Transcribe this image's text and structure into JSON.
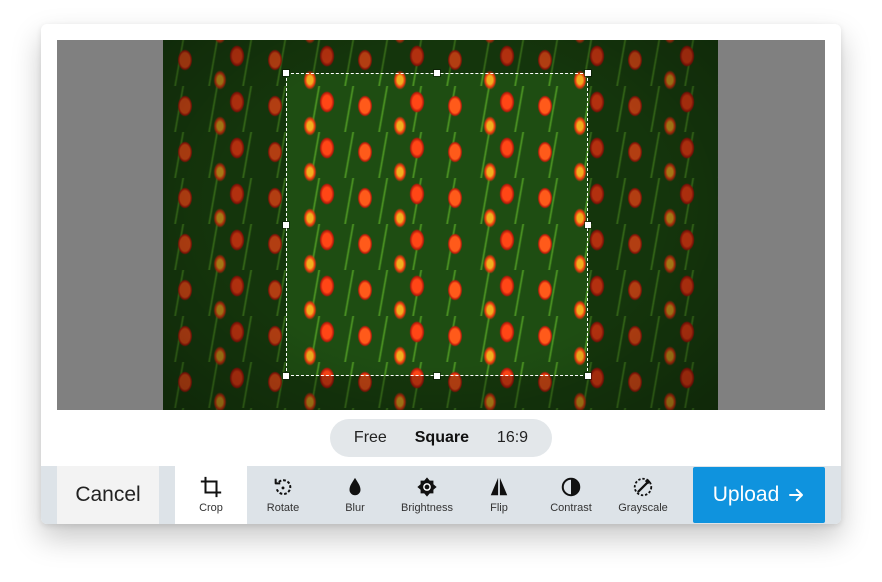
{
  "aspect": {
    "options": [
      {
        "label": "Free",
        "active": false
      },
      {
        "label": "Square",
        "active": true
      },
      {
        "label": "16:9",
        "active": false
      }
    ]
  },
  "toolbar": {
    "cancel_label": "Cancel",
    "upload_label": "Upload",
    "active_tool": "Crop",
    "tools": [
      {
        "label": "Crop",
        "icon": "crop-icon"
      },
      {
        "label": "Rotate",
        "icon": "rotate-icon"
      },
      {
        "label": "Blur",
        "icon": "blur-icon"
      },
      {
        "label": "Brightness",
        "icon": "brightness-icon"
      },
      {
        "label": "Flip",
        "icon": "flip-icon"
      },
      {
        "label": "Contrast",
        "icon": "contrast-icon"
      },
      {
        "label": "Grayscale",
        "icon": "grayscale-icon"
      }
    ]
  },
  "colors": {
    "accent": "#0f93de",
    "toolbar_bg": "#dde3e8",
    "stage_bg": "#808080"
  }
}
